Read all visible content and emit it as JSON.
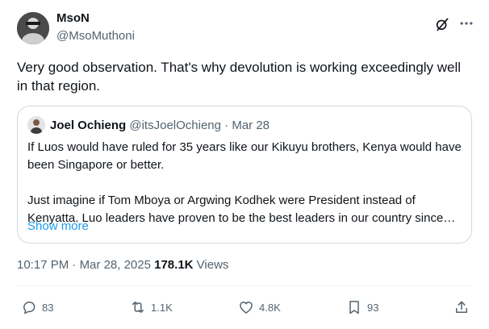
{
  "author": {
    "name": "MsoN",
    "handle": "@MsoMuthoni"
  },
  "tweet": {
    "text": "Very good observation. That's why devolution is working exceedingly well in that region."
  },
  "quote": {
    "name": "Joel Ochieng",
    "handle": "@itsJoelOchieng",
    "separator": "·",
    "date": "Mar 28",
    "paragraph1": "If Luos would have ruled for 35 years like our Kikuyu brothers, Kenya would have been Singapore or better.",
    "paragraph2": "Just imagine if Tom Mboya or Argwing Kodhek were President instead of Kenyatta. Luo leaders have proven to be the best leaders in our country since independence.",
    "show_more": "Show more"
  },
  "meta": {
    "time": "10:17 PM",
    "separator": "·",
    "date": "Mar 28, 2025",
    "views_count": "178.1K",
    "views_label": "Views"
  },
  "actions": {
    "replies": "83",
    "reposts": "1.1K",
    "likes": "4.8K",
    "bookmarks": "93"
  },
  "icons": {
    "grok": "grok-icon",
    "more": "more-icon",
    "reply": "reply-icon",
    "repost": "repost-icon",
    "like": "heart-icon",
    "bookmark": "bookmark-icon",
    "share": "share-icon"
  },
  "colors": {
    "text": "#0f1419",
    "secondary": "#536471",
    "link": "#1d9bf0",
    "border": "#cfd9de"
  }
}
